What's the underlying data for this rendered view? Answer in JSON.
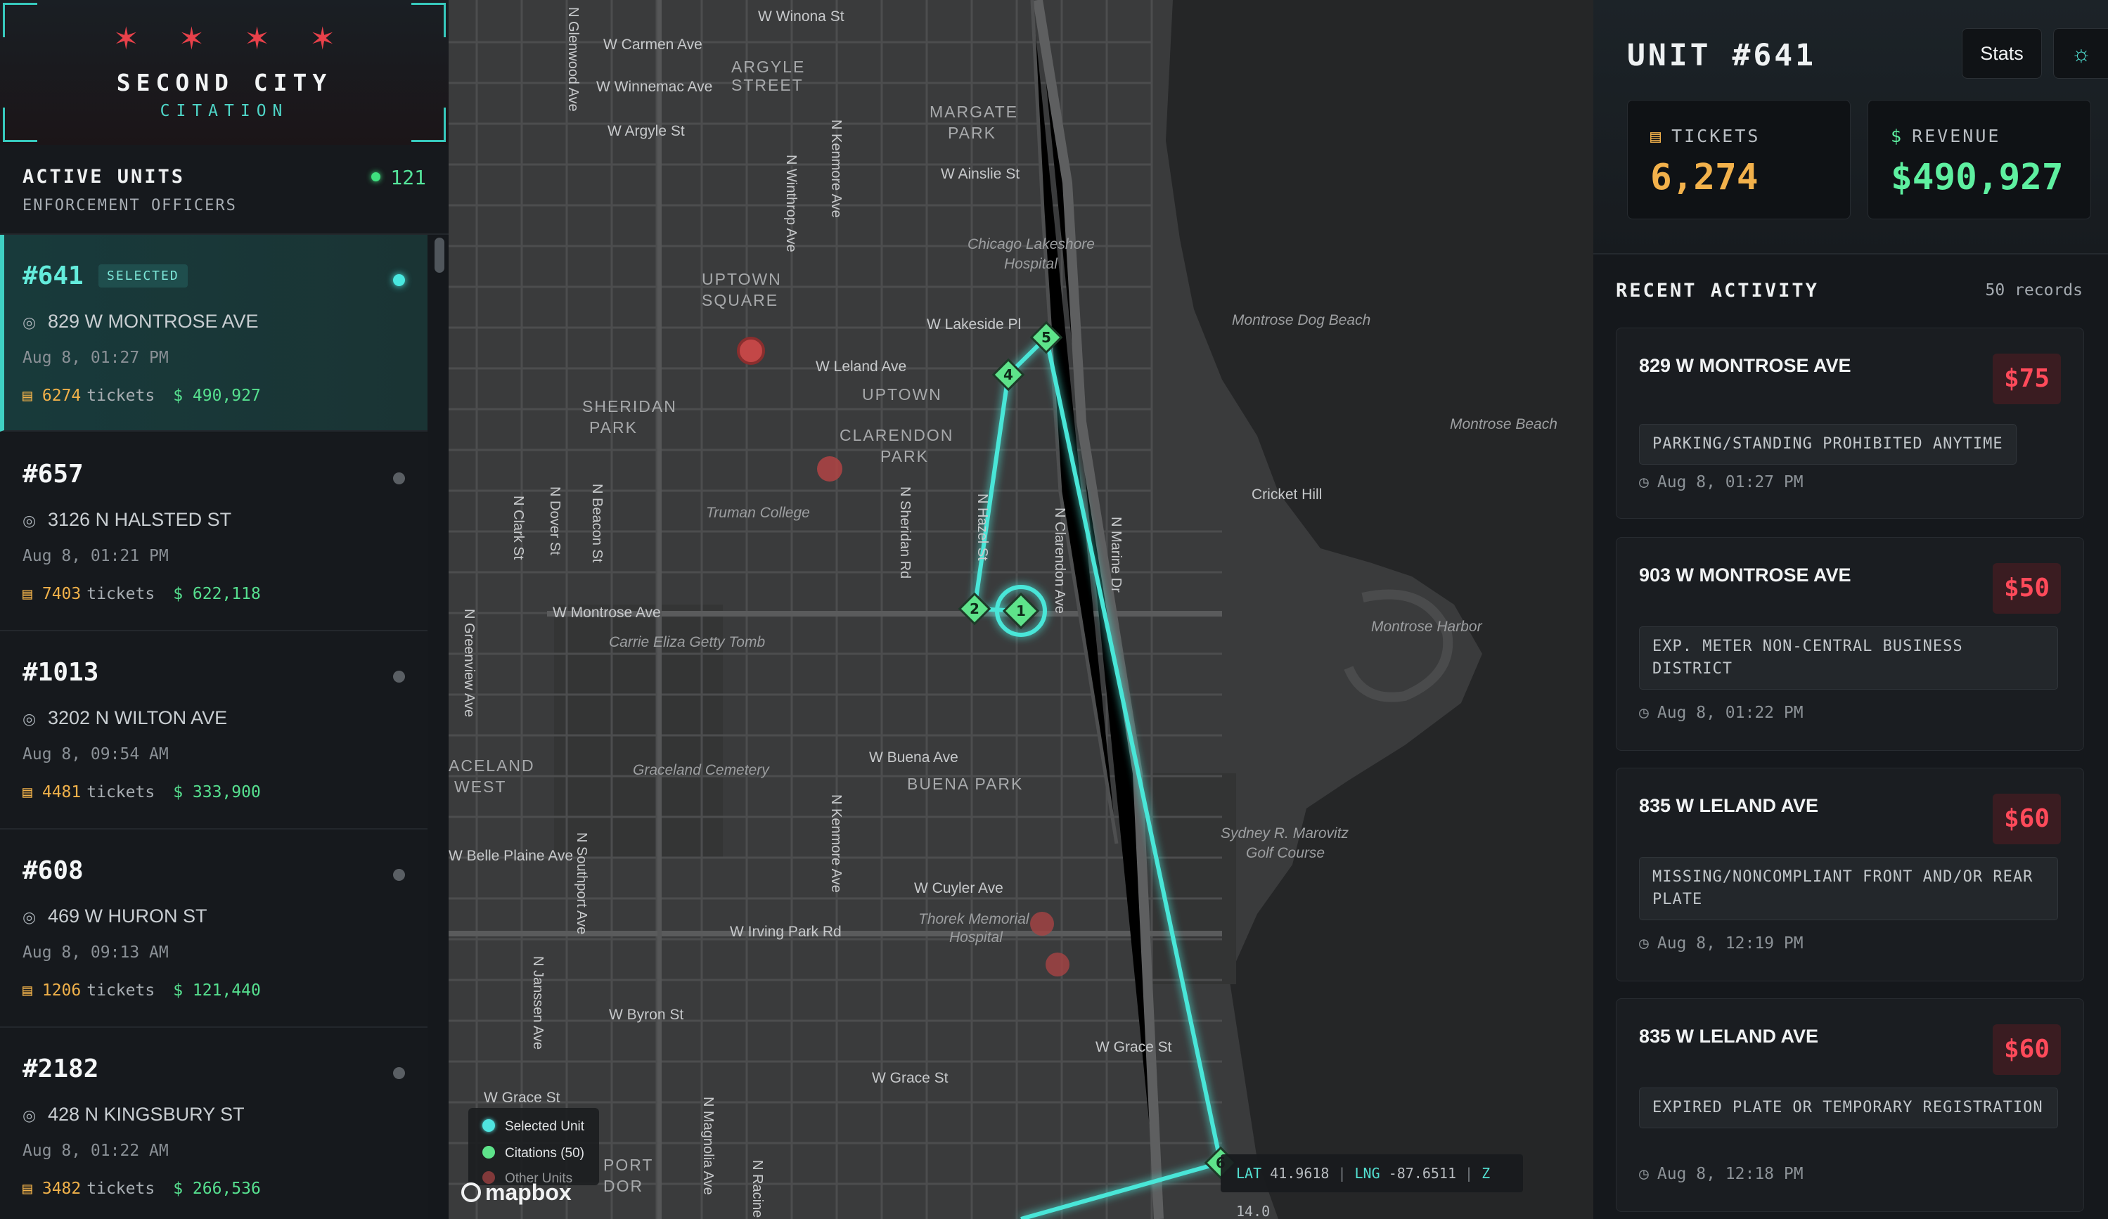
{
  "brand": {
    "stars": "✶ ✶ ✶ ✶",
    "title": "SECOND CITY",
    "subtitle": "CITATION"
  },
  "units_panel": {
    "title": "ACTIVE UNITS",
    "subtitle": "ENFORCEMENT OFFICERS",
    "count": "121",
    "tickets_word": "tickets",
    "units": [
      {
        "id": "#641",
        "badge": "SELECTED",
        "address": "829 W MONTROSE AVE",
        "time": "Aug 8, 01:27 PM",
        "tickets": "6274",
        "revenue": "$ 490,927",
        "selected": true
      },
      {
        "id": "#657",
        "address": "3126 N HALSTED ST",
        "time": "Aug 8, 01:21 PM",
        "tickets": "7403",
        "revenue": "$ 622,118"
      },
      {
        "id": "#1013",
        "address": "3202 N WILTON AVE",
        "time": "Aug 8, 09:54 AM",
        "tickets": "4481",
        "revenue": "$ 333,900"
      },
      {
        "id": "#608",
        "address": "469 W HURON ST",
        "time": "Aug 8, 09:13 AM",
        "tickets": "1206",
        "revenue": "$ 121,440"
      },
      {
        "id": "#2182",
        "address": "428 N KINGSBURY ST",
        "time": "Aug 8, 01:22 AM",
        "tickets": "3482",
        "revenue": "$ 266,536"
      }
    ]
  },
  "map": {
    "area_labels": [
      "ARGYLE",
      "STREET",
      "MARGATE",
      "PARK",
      "UPTOWN",
      "SQUARE",
      "UPTOWN",
      "SHERIDAN",
      "PARK",
      "CLARENDON",
      "PARK",
      "BUENA PARK",
      "ACELAND",
      "WEST",
      "PORT",
      "DOR"
    ],
    "street_labels": [
      "W Winona St",
      "W Carmen Ave",
      "W Winnemac Ave",
      "W Argyle St",
      "W Ainslie St",
      "W Lakeside Pl",
      "W Leland Ave",
      "W Montrose Ave",
      "W Buena Ave",
      "W Belle Plaine Ave",
      "W Cuyler Ave",
      "W Irving Park Rd",
      "W Byron St",
      "W Grace St",
      "W Grace St",
      "W Grace St",
      "Cricket Hill"
    ],
    "vertical_street_labels": [
      "N Glenwood Ave",
      "N Winthrop Ave",
      "N Kenmore Ave",
      "N Clark St",
      "N Dover St",
      "N Beacon St",
      "N Sheridan Rd",
      "N Hazel St",
      "N Clarendon Ave",
      "N Marine Dr",
      "N Greenview Ave",
      "N Southport Ave",
      "N Kenmore Ave",
      "N Janssen Ave",
      "N Magnolia Ave",
      "N Racine"
    ],
    "poi_labels": [
      "Chicago Lakeshore",
      "Hospital",
      "Montrose Dog Beach",
      "Montrose Beach",
      "Truman College",
      "Carrie Eliza Getty Tomb",
      "Montrose Harbor",
      "Graceland Cemetery",
      "Sydney R. Marovitz",
      "Golf Course",
      "Thorek Memorial",
      "Hospital"
    ],
    "route_markers": [
      "1",
      "2",
      "4",
      "5",
      "6"
    ],
    "legend": {
      "selected": "Selected Unit",
      "citations": "Citations (50)",
      "other": "Other Units"
    },
    "attribution": "mapbox",
    "coords": {
      "lat_label": "LAT",
      "lat": "41.9618",
      "lng_label": "LNG",
      "lng": "-87.6511",
      "zoom_label": "Z",
      "zoom": "14.0"
    },
    "colors": {
      "route": "#48e6d8",
      "citation": "#5ee38a",
      "other_unit": "#c44a4a"
    }
  },
  "detail": {
    "unit_title": "UNIT #641",
    "stats_button": "Stats",
    "theme_icon": "sun-icon",
    "tickets_label": "TICKETS",
    "tickets_value": "6,274",
    "revenue_label": "REVENUE",
    "revenue_value": "$490,927",
    "activity_title": "RECENT ACTIVITY",
    "activity_count": "50 records",
    "activity": [
      {
        "address": "829 W MONTROSE AVE",
        "amount": "$75",
        "violation": "PARKING/STANDING PROHIBITED ANYTIME",
        "time": "Aug 8, 01:27 PM"
      },
      {
        "address": "903 W MONTROSE AVE",
        "amount": "$50",
        "violation": "EXP. METER NON-CENTRAL BUSINESS DISTRICT",
        "time": "Aug 8, 01:22 PM"
      },
      {
        "address": "835 W LELAND AVE",
        "amount": "$60",
        "violation": "MISSING/NONCOMPLIANT FRONT AND/OR REAR PLATE",
        "time": "Aug 8, 12:19 PM"
      },
      {
        "address": "835 W LELAND AVE",
        "amount": "$60",
        "violation": "EXPIRED PLATE OR TEMPORARY REGISTRATION",
        "time": "Aug 8, 12:18 PM"
      }
    ]
  }
}
